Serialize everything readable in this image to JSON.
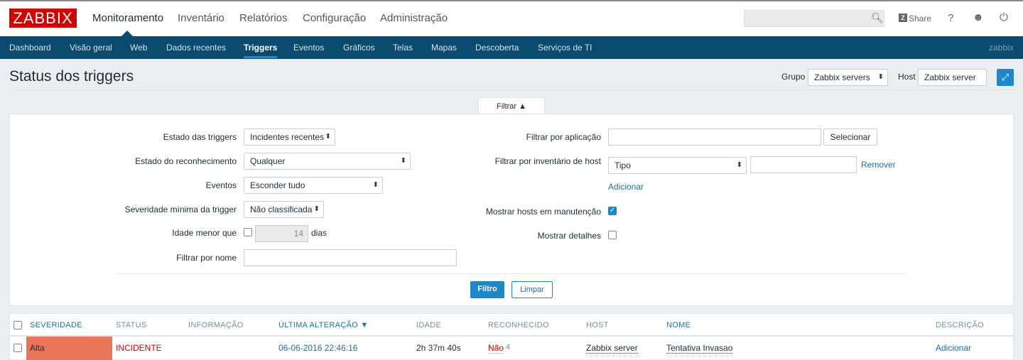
{
  "logo": "ZABBIX",
  "main_menu": [
    "Monitoramento",
    "Inventário",
    "Relatórios",
    "Configuração",
    "Administração"
  ],
  "header_actions": {
    "search_placeholder": "",
    "share": "Share",
    "help": "?"
  },
  "sub_menu": [
    "Dashboard",
    "Visão geral",
    "Web",
    "Dados recentes",
    "Triggers",
    "Eventos",
    "Gráficos",
    "Telas",
    "Mapas",
    "Descoberta",
    "Serviços de TI"
  ],
  "user": "zabbix",
  "page": {
    "title": "Status dos triggers",
    "group_label": "Grupo",
    "group_value": "Zabbix servers",
    "host_label": "Host",
    "host_value": "Zabbix server"
  },
  "filter": {
    "tab": "Filtrar ▲",
    "left": {
      "state_label": "Estado das triggers",
      "state_value": "Incidentes recentes",
      "ack_label": "Estado do reconhecimento",
      "ack_value": "Qualquer",
      "events_label": "Eventos",
      "events_value": "Esconder tudo",
      "severity_label": "Severidade mínima da trigger",
      "severity_value": "Não classificada",
      "age_label": "Idade menor que",
      "age_value": "14",
      "age_unit": "dias",
      "age_checked": false,
      "name_label": "Filtrar por nome",
      "name_value": ""
    },
    "right": {
      "app_label": "Filtrar por aplicação",
      "app_value": "",
      "select": "Selecionar",
      "inv_label": "Filtrar por inventário de host",
      "inv_field": "Tipo",
      "inv_value": "",
      "remove": "Remover",
      "add": "Adicionar",
      "maint_label": "Mostrar hosts em manutenção",
      "maint_checked": true,
      "details_label": "Mostrar detalhes",
      "details_checked": false
    },
    "apply": "Filtro",
    "reset": "Limpar"
  },
  "table": {
    "headers": [
      "SEVERIDADE",
      "STATUS",
      "INFORMAÇÃO",
      "ÚLTIMA ALTERAÇÃO ▼",
      "IDADE",
      "RECONHECIDO",
      "HOST",
      "NOME",
      "DESCRIÇÃO"
    ],
    "rows": [
      {
        "severity": "Alta",
        "severity_color": "#e97659",
        "status": "INCIDENTE",
        "info": "",
        "last_change": "06-06-2016 22:46:16",
        "age": "2h 37m 40s",
        "ack": "Não",
        "ack_count": "4",
        "host": "Zabbix server",
        "name": "Tentativa Invasao",
        "description": "Adicionar"
      }
    ]
  }
}
